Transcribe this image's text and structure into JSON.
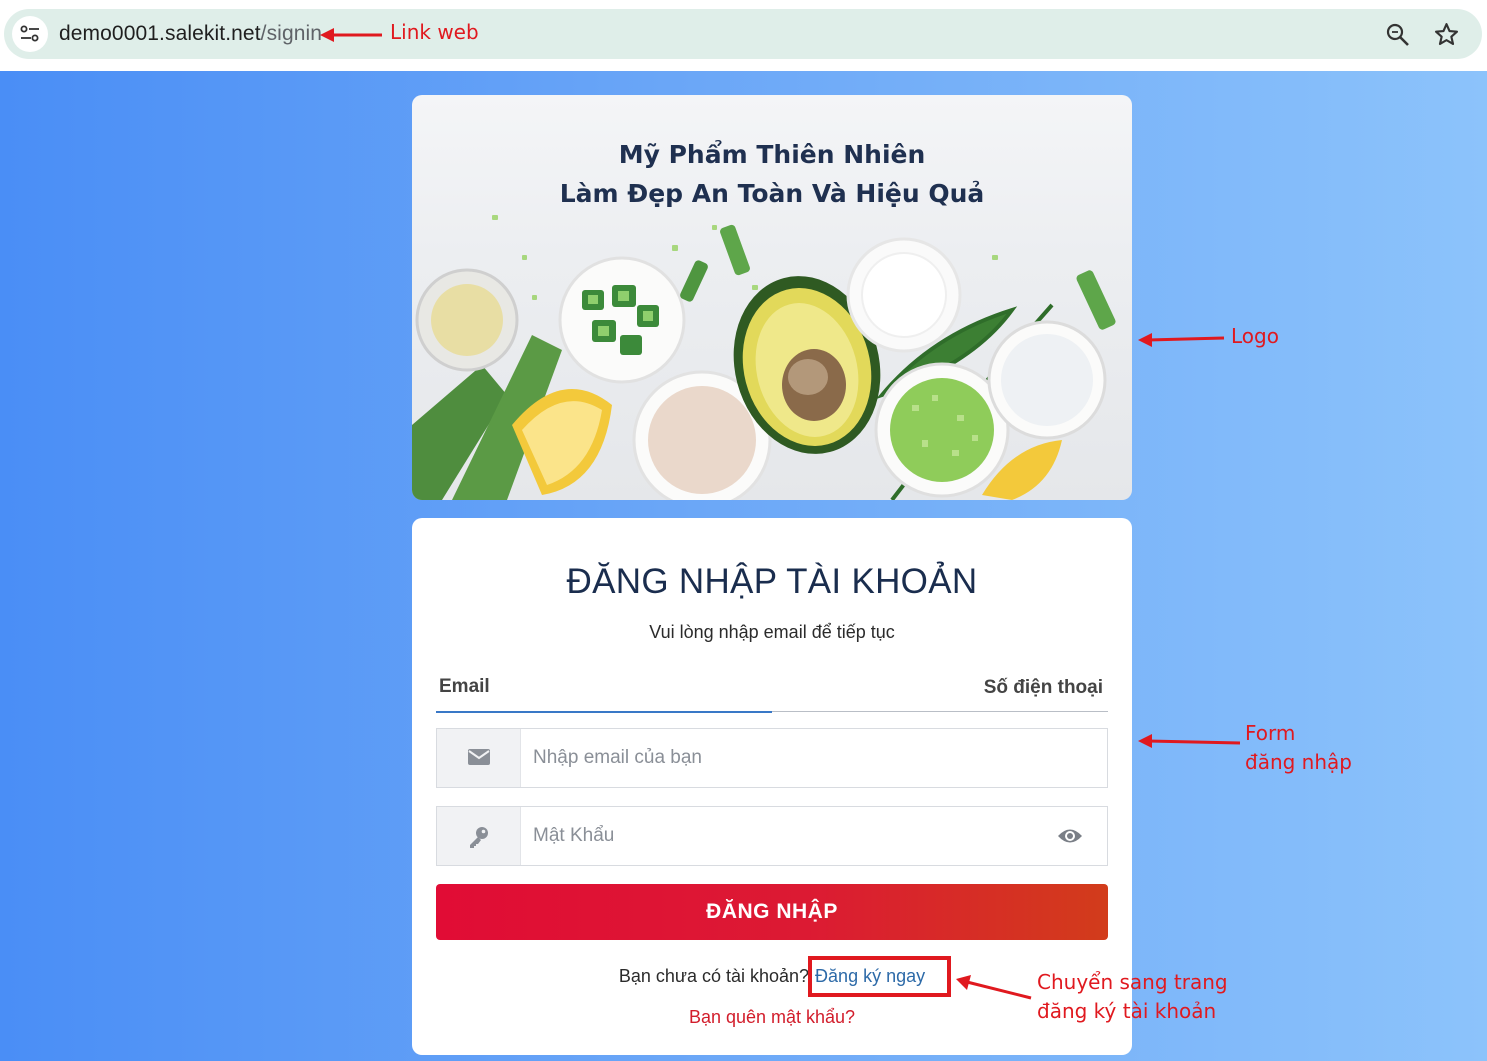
{
  "browser": {
    "url_host": "demo0001.salekit.net",
    "url_path": "/signin",
    "icons": {
      "site_info": "tune-icon",
      "zoom": "zoom-icon",
      "bookmark": "star-icon"
    }
  },
  "banner": {
    "title_line1": "Mỹ Phẩm Thiên Nhiên",
    "title_line2": "Làm Đẹp An Toàn Và Hiệu Quả"
  },
  "login": {
    "title": "ĐĂNG NHẬP TÀI KHOẢN",
    "subtitle": "Vui lòng nhập email để tiếp tục",
    "tabs": [
      "Email",
      "Số điện thoại"
    ],
    "active_tab": "Email",
    "email_placeholder": "Nhập email của bạn",
    "password_placeholder": "Mật Khẩu",
    "submit_label": "ĐĂNG NHẬP",
    "signup_prompt": "Bạn chưa có tài khoản?",
    "signup_link": "Đăng ký ngay",
    "forgot_password": "Bạn quên mật khẩu?"
  },
  "annotations": {
    "link_web": "Link web",
    "logo": "Logo",
    "form_line1": "Form",
    "form_line2": "đăng nhập",
    "signup_line1": "Chuyển sang trang",
    "signup_line2": "đăng ký tài khoản",
    "color": "#e0191f"
  },
  "colors": {
    "login_button": "#e10c35",
    "title": "#1a2d4e",
    "link": "#2d6aa8",
    "active_tab": "#3978c7"
  }
}
